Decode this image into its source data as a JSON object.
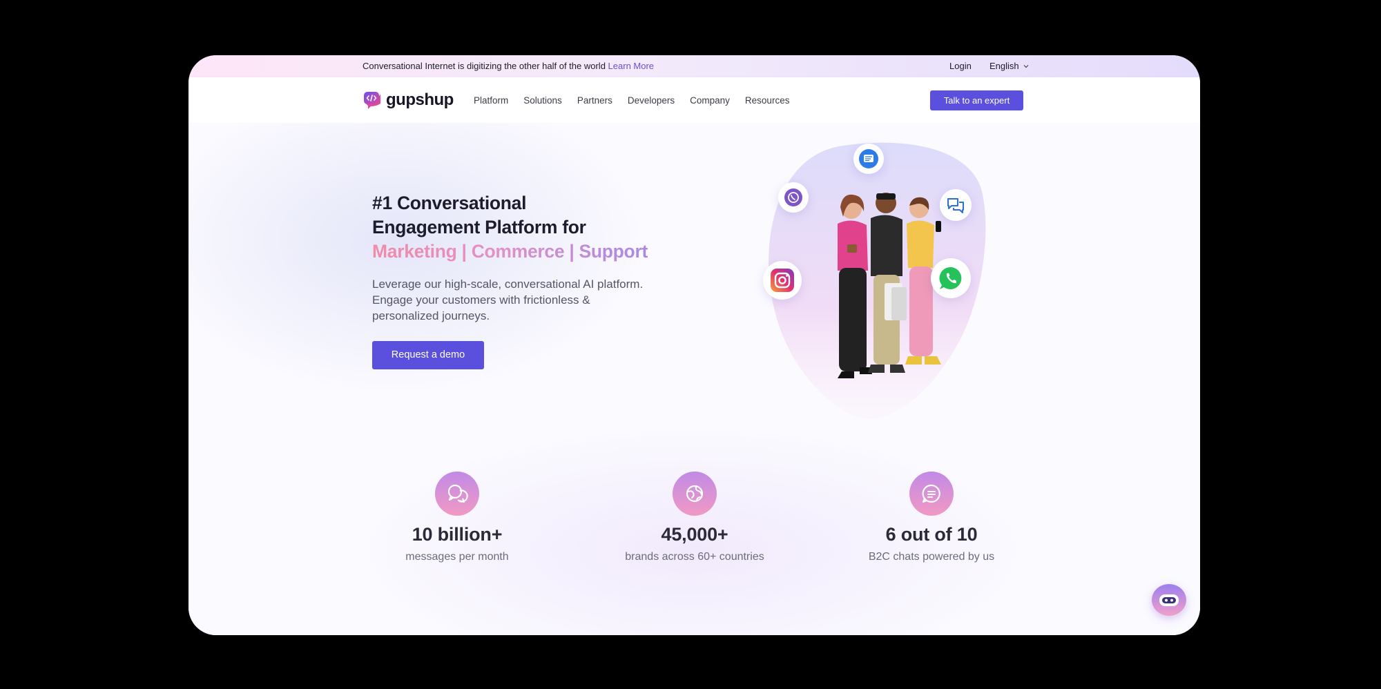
{
  "announcement": {
    "text": "Conversational Internet is digitizing the other half of the world",
    "link": "Learn More"
  },
  "utility": {
    "login": "Login",
    "language": "English"
  },
  "brand": {
    "name": "gupshup",
    "accent": "#5b4fde"
  },
  "nav": {
    "items": [
      "Platform",
      "Solutions",
      "Partners",
      "Developers",
      "Company",
      "Resources"
    ],
    "cta": "Talk to an expert"
  },
  "hero": {
    "title_line1": "#1 Conversational",
    "title_line2": "Engagement Platform for",
    "title_highlight": "Marketing | Commerce | Support",
    "subtitle": "Leverage our high-scale, conversational AI platform. Engage your customers with frictionless & personalized journeys.",
    "cta": "Request a demo"
  },
  "illustration": {
    "icons": [
      "sms-icon",
      "viber-icon",
      "chat-icon",
      "instagram-icon",
      "whatsapp-icon"
    ]
  },
  "stats": [
    {
      "icon": "chat-bubbles-icon",
      "value": "10 billion+",
      "caption": "messages per month"
    },
    {
      "icon": "globe-icon",
      "value": "45,000+",
      "caption": "brands across 60+ countries"
    },
    {
      "icon": "message-icon",
      "value": "6 out of 10",
      "caption": "B2C chats powered by us"
    }
  ],
  "chat_widget": {
    "icon": "chatbot-icon"
  }
}
